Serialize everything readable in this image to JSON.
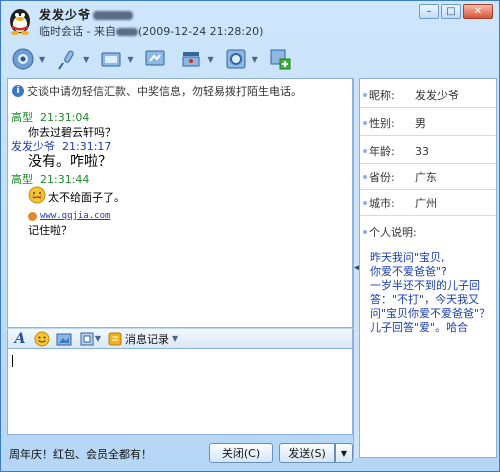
{
  "title": {
    "name": "发发少爷",
    "subtitle": "临时会话 - 来自",
    "datetime": "(2009-12-24 21:28:20)"
  },
  "toolbar": {
    "icons": [
      "video-call-icon",
      "voice-call-icon",
      "file-transfer-icon",
      "remote-assist-icon",
      "app-settings-icon",
      "add-app-icon"
    ]
  },
  "chat": {
    "notice": "交谈中请勿轻信汇款、中奖信息，勿轻易拨打陌生电话。",
    "messages": [
      {
        "sender": "高型",
        "time": "21:31:04",
        "text": "你去过碧云轩吗？"
      },
      {
        "sender": "发发少爷",
        "time": "21:31:17",
        "text": "没有。咋啦？"
      },
      {
        "sender": "高型",
        "time": "21:31:44",
        "text": "太不给面子了。",
        "link": "www.qqjia.com",
        "text2": "记住啦？"
      }
    ]
  },
  "input_toolbar": {
    "history_label": "消息记录"
  },
  "bottom": {
    "promo": "周年庆！红包、会员全都有！",
    "close_label": "关闭(C)",
    "send_label": "发送(S)"
  },
  "profile": {
    "fields": [
      {
        "label": "昵称:",
        "value": "发发少爷"
      },
      {
        "label": "性别:",
        "value": "男"
      },
      {
        "label": "年龄:",
        "value": "33"
      },
      {
        "label": "省份:",
        "value": "广东"
      },
      {
        "label": "城市:",
        "value": "广州"
      }
    ],
    "intro_label": "个人说明:",
    "intro_text": "昨天我问\"宝贝,\n你爱不爱爸爸\"?\n一岁半还不到的儿子回答：\"不打\"，今天我又问\"宝贝你爱不爱爸爸\"？儿子回答\"爱\"。哈合"
  },
  "colors": {
    "window_bg": "#b5d6f5",
    "border": "#8fb3d8",
    "other_sender": "#1c8a2a",
    "self_sender": "#1a3fa8"
  }
}
